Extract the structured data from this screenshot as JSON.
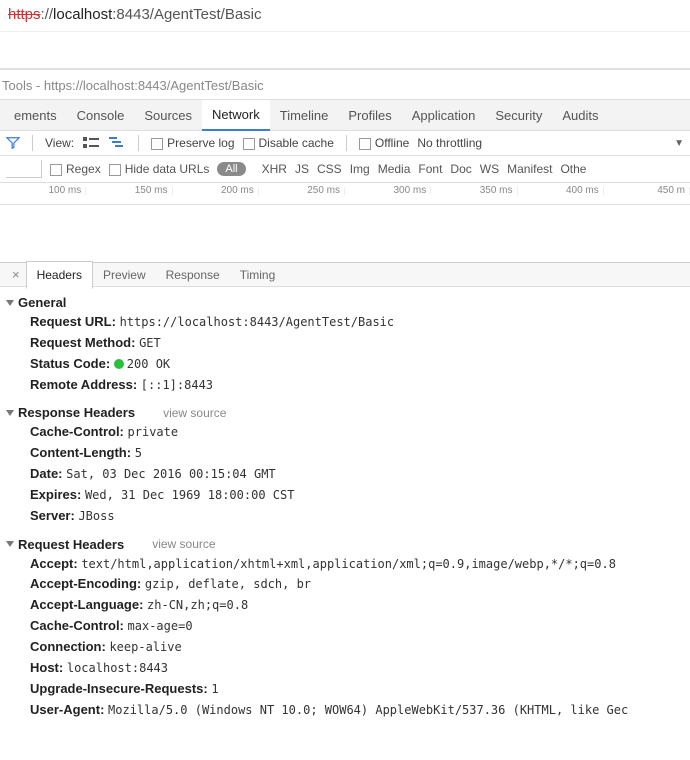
{
  "address_bar": {
    "protocol_struck": "https",
    "sep": "://",
    "host": "localhost",
    "port_path": ":8443/AgentTest/Basic"
  },
  "devtools_title": "Tools - https://localhost:8443/AgentTest/Basic",
  "panel_tabs": [
    "ements",
    "Console",
    "Sources",
    "Network",
    "Timeline",
    "Profiles",
    "Application",
    "Security",
    "Audits"
  ],
  "panel_tabs_active": "Network",
  "toolbar": {
    "view_label": "View:",
    "preserve_log": "Preserve log",
    "disable_cache": "Disable cache",
    "offline": "Offline",
    "throttling": "No throttling"
  },
  "filter_row": {
    "regex": "Regex",
    "hide_data_urls": "Hide data URLs",
    "all": "All",
    "types": [
      "XHR",
      "JS",
      "CSS",
      "Img",
      "Media",
      "Font",
      "Doc",
      "WS",
      "Manifest",
      "Othe"
    ]
  },
  "timeline_ticks": [
    "100 ms",
    "150 ms",
    "200 ms",
    "250 ms",
    "300 ms",
    "350 ms",
    "400 ms",
    "450 m"
  ],
  "request_tabs": [
    "Headers",
    "Preview",
    "Response",
    "Timing"
  ],
  "request_tabs_active": "Headers",
  "general": {
    "title": "General",
    "request_url_k": "Request URL:",
    "request_url_v": "https://localhost:8443/AgentTest/Basic",
    "request_method_k": "Request Method:",
    "request_method_v": "GET",
    "status_code_k": "Status Code:",
    "status_code_v": "200 OK",
    "remote_address_k": "Remote Address:",
    "remote_address_v": "[::1]:8443"
  },
  "response_headers": {
    "title": "Response Headers",
    "view_source": "view source",
    "items": [
      {
        "k": "Cache-Control:",
        "v": "private"
      },
      {
        "k": "Content-Length:",
        "v": "5"
      },
      {
        "k": "Date:",
        "v": "Sat, 03 Dec 2016 00:15:04 GMT"
      },
      {
        "k": "Expires:",
        "v": "Wed, 31 Dec 1969 18:00:00 CST"
      },
      {
        "k": "Server:",
        "v": "JBoss"
      }
    ]
  },
  "request_headers": {
    "title": "Request Headers",
    "view_source": "view source",
    "items": [
      {
        "k": "Accept:",
        "v": "text/html,application/xhtml+xml,application/xml;q=0.9,image/webp,*/*;q=0.8"
      },
      {
        "k": "Accept-Encoding:",
        "v": "gzip, deflate, sdch, br"
      },
      {
        "k": "Accept-Language:",
        "v": "zh-CN,zh;q=0.8"
      },
      {
        "k": "Cache-Control:",
        "v": "max-age=0"
      },
      {
        "k": "Connection:",
        "v": "keep-alive"
      },
      {
        "k": "Host:",
        "v": "localhost:8443"
      },
      {
        "k": "Upgrade-Insecure-Requests:",
        "v": "1"
      },
      {
        "k": "User-Agent:",
        "v": "Mozilla/5.0 (Windows NT 10.0; WOW64) AppleWebKit/537.36 (KHTML, like Gec"
      }
    ]
  },
  "watermark": ""
}
